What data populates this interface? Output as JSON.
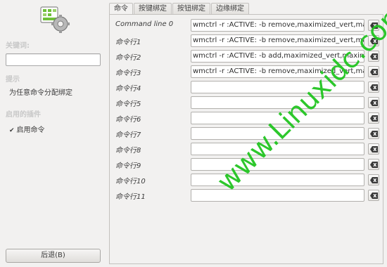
{
  "sidebar": {
    "search_label": "关键词:",
    "search_value": "",
    "hint_label": "提示",
    "hint_text": "为任意命令分配绑定",
    "plugin_label": "启用的插件",
    "plugin_item": "启用命令",
    "plugin_checked": true,
    "back_button": "后退(B)"
  },
  "tabs": [
    "命令",
    "按键绑定",
    "按钮绑定",
    "边缘绑定"
  ],
  "active_tab": 0,
  "commands": [
    {
      "label": "Command line 0",
      "value": "wmctrl -r :ACTIVE: -b remove,maximized_vert,maximized_horz"
    },
    {
      "label": "命令行1",
      "value": "wmctrl -r :ACTIVE: -b remove,maximized_vert,maximized_horz"
    },
    {
      "label": "命令行2",
      "value": "wmctrl -r :ACTIVE: -b add,maximized_vert,maximized_horz"
    },
    {
      "label": "命令行3",
      "value": "wmctrl -r :ACTIVE: -b remove,maximized_vert,maximized_horz"
    },
    {
      "label": "命令行4",
      "value": ""
    },
    {
      "label": "命令行5",
      "value": ""
    },
    {
      "label": "命令行6",
      "value": ""
    },
    {
      "label": "命令行7",
      "value": ""
    },
    {
      "label": "命令行8",
      "value": ""
    },
    {
      "label": "命令行9",
      "value": ""
    },
    {
      "label": "命令行10",
      "value": ""
    },
    {
      "label": "命令行11",
      "value": ""
    }
  ],
  "watermark": "www.Linuxidc.com",
  "colors": {
    "watermark": "#22c521",
    "background": "#f2f1f0"
  }
}
